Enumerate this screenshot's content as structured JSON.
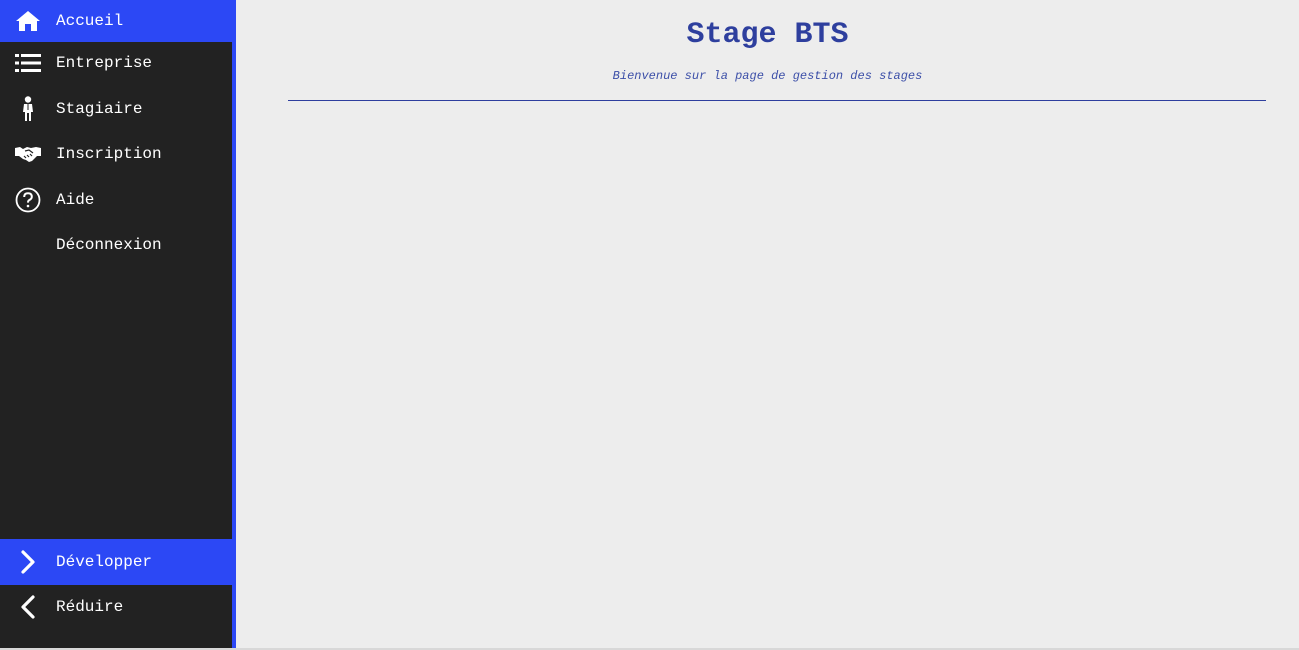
{
  "sidebar": {
    "items": [
      {
        "label": "Accueil",
        "icon": "home-icon"
      },
      {
        "label": "Entreprise",
        "icon": "list-icon"
      },
      {
        "label": "Stagiaire",
        "icon": "person-icon"
      },
      {
        "label": "Inscription",
        "icon": "handshake-icon"
      },
      {
        "label": "Aide",
        "icon": "help-circle-icon"
      },
      {
        "label": "Déconnexion",
        "icon": ""
      }
    ],
    "bottom": [
      {
        "label": "Développer",
        "icon": "chevron-right-icon"
      },
      {
        "label": "Réduire",
        "icon": "chevron-left-icon"
      }
    ]
  },
  "main": {
    "title": "Stage BTS",
    "subtitle": "Bienvenue sur la page de gestion des stages"
  },
  "colors": {
    "accent": "#2c48f5",
    "sidebar_bg": "#222222",
    "title": "#2e3f9e",
    "page_bg": "#ededed"
  }
}
